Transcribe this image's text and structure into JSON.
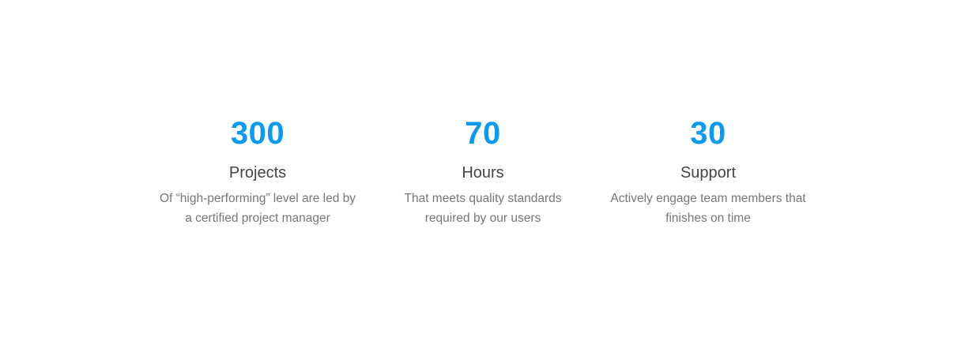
{
  "colors": {
    "accent": "#0a9af0",
    "title": "#444444",
    "text": "#777777",
    "background": "#ffffff"
  },
  "stats": [
    {
      "number": "300",
      "title": "Projects",
      "desc_line1": "Of “high-performing” level are led by",
      "desc_line2": "a certified project manager"
    },
    {
      "number": "70",
      "title": "Hours",
      "desc_line1": "That meets quality standards",
      "desc_line2": "required by our users"
    },
    {
      "number": "30",
      "title": "Support",
      "desc_line1": "Actively engage team members that",
      "desc_line2": "finishes on time"
    }
  ]
}
